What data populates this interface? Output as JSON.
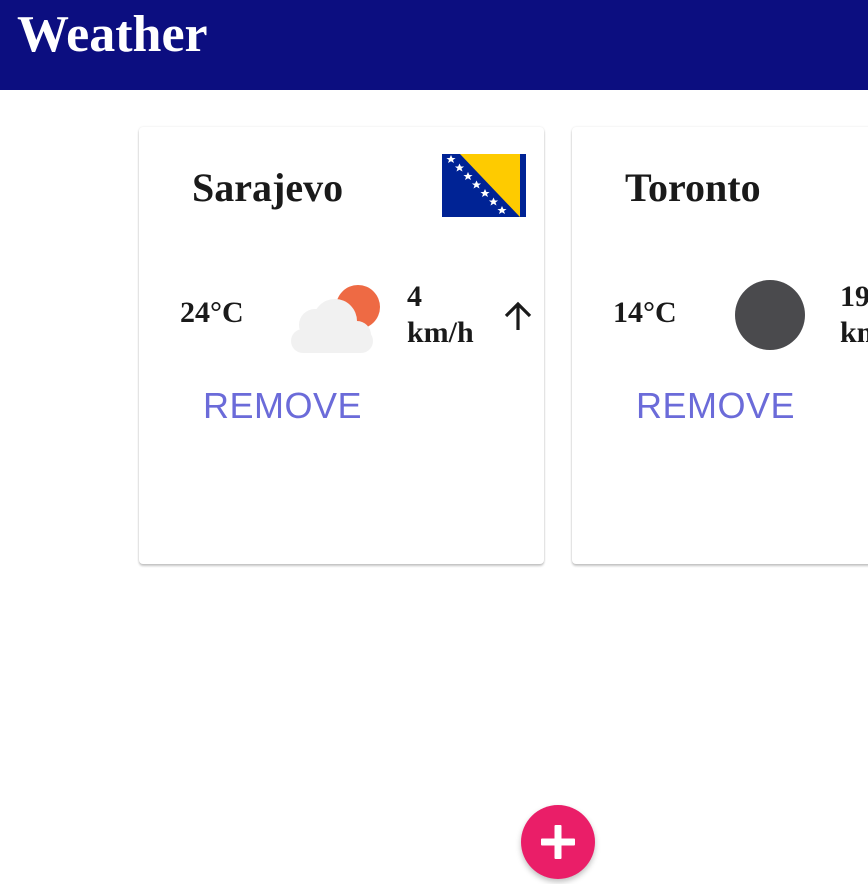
{
  "app": {
    "title": "Weather"
  },
  "cards": [
    {
      "city": "Sarajevo",
      "temperature": "24°C",
      "weather_icon": "partly-cloudy-icon",
      "wind_speed": "4",
      "wind_unit": "km/h",
      "wind_direction_icon": "arrow-up-icon",
      "flag_icon": "bosnia-and-herzegovina-flag-icon",
      "remove_label": "REMOVE"
    },
    {
      "city": "Toronto",
      "temperature": "14°C",
      "weather_icon": "loading-placeholder-icon",
      "wind_speed": "19",
      "wind_unit": "km/h",
      "remove_label": "REMOVE"
    }
  ],
  "fab": {
    "icon": "plus-icon"
  },
  "colors": {
    "app_bar": "#0c0e80",
    "remove_text": "#6b6bd9",
    "fab": "#ea1e68",
    "sun": "#ee6a44"
  }
}
